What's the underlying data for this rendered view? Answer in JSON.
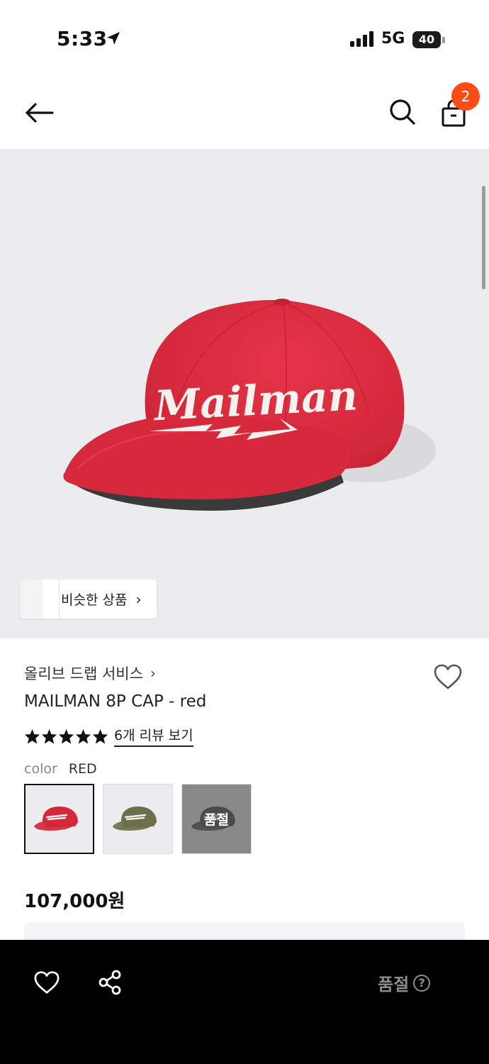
{
  "status_bar": {
    "time": "5:33",
    "network": "5G",
    "battery": "40"
  },
  "nav": {
    "cart_count": "2"
  },
  "hero": {
    "logo_text": "Mailman",
    "similar_products_label": "비슷한 상품"
  },
  "product": {
    "brand": "올리브 드랩 서비스",
    "name": "MAILMAN 8P CAP - red",
    "rating": 5,
    "reviews_link": "6개 리뷰 보기",
    "color_label": "color",
    "color_value": "RED",
    "swatches": [
      {
        "color": "#d3283a",
        "selected": true,
        "sold_out": false
      },
      {
        "color": "#6d6f4c",
        "selected": false,
        "sold_out": false
      },
      {
        "color": "#2e2e2e",
        "selected": false,
        "sold_out": true,
        "sold_out_label": "품절"
      }
    ],
    "price": "107,000원"
  },
  "bottom_bar": {
    "sold_out_label": "품절",
    "help_glyph": "?"
  },
  "colors": {
    "accent_badge": "#ff4b14",
    "cap_red": "#d3283a",
    "bottom_bar": "#000000"
  }
}
